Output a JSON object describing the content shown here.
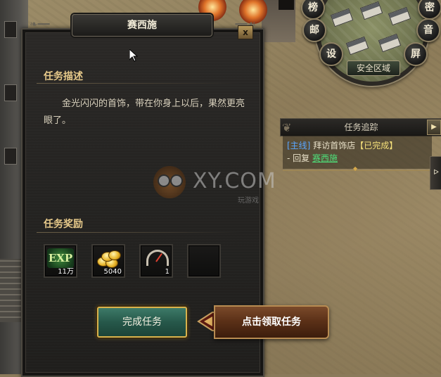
{
  "minimap": {
    "zone_label": "安全区域",
    "buttons": [
      "榜",
      "密",
      "邮",
      "音",
      "设",
      "屏"
    ]
  },
  "quest_tracker": {
    "title": "任务追踪",
    "quest_type": "[主线]",
    "quest_name": "拜访首饰店",
    "quest_status": "【已完成】",
    "reply_prefix": "- 回复",
    "reply_npc": "赛西施",
    "side_tab_label": "ᐅ"
  },
  "dialog": {
    "title": "赛西施",
    "close_label": "x",
    "description_heading": "任务描述",
    "description_text": "金光闪闪的首饰，带在你身上以后，果然更亮眼了。",
    "rewards_heading": "任务奖励",
    "rewards": [
      {
        "icon": "exp-icon",
        "icon_text": "EXP",
        "count": "11万"
      },
      {
        "icon": "gold-coins-icon",
        "count": "5040"
      },
      {
        "icon": "gauge-icon",
        "count": "1"
      },
      {
        "icon": "empty-slot",
        "count": ""
      }
    ],
    "complete_button": "完成任务"
  },
  "hint": {
    "label": "点击领取任务"
  },
  "watermark": {
    "text": "XY.COM",
    "sub": "玩游戏"
  }
}
